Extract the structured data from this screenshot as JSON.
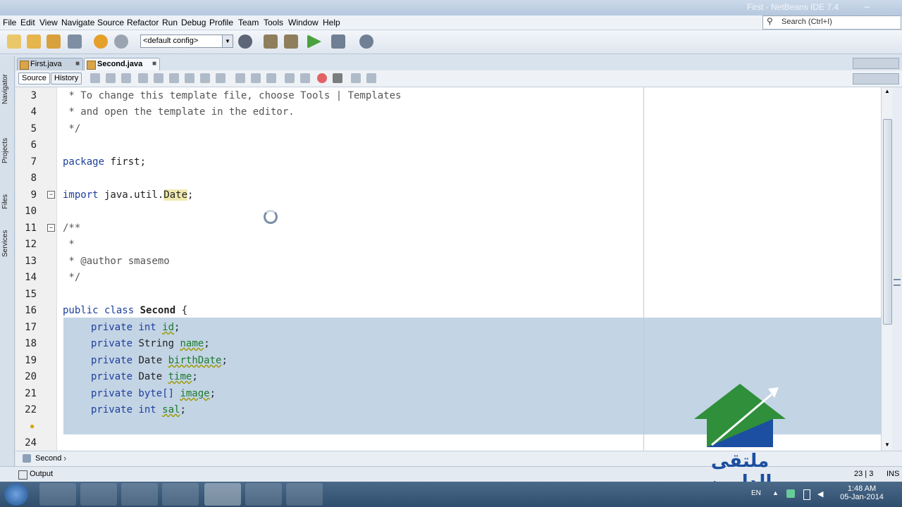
{
  "window": {
    "title": "First - NetBeans IDE 7.4"
  },
  "menu": [
    "File",
    "Edit",
    "View",
    "Navigate",
    "Source",
    "Refactor",
    "Run",
    "Debug",
    "Profile",
    "Team",
    "Tools",
    "Window",
    "Help"
  ],
  "search": {
    "placeholder": "Search (Ctrl+I)"
  },
  "toolbar": {
    "config_value": "<default config>"
  },
  "side_tabs": [
    "Navigator",
    "Projects",
    "Files",
    "Services"
  ],
  "tabs": [
    {
      "label": "First.java",
      "active": false
    },
    {
      "label": "Second.java",
      "active": true
    }
  ],
  "editor_tabs": {
    "source": "Source",
    "history": "History"
  },
  "code_lines": [
    {
      "num": "3",
      "text": " * To change this template file, choose Tools | Templates"
    },
    {
      "num": "4",
      "text": " * and open the template in the editor."
    },
    {
      "num": "5",
      "text": " */"
    },
    {
      "num": "6",
      "text": ""
    },
    {
      "num": "7",
      "kw": "package",
      "text": " first;"
    },
    {
      "num": "8",
      "text": ""
    },
    {
      "num": "9",
      "kw": "import",
      "text": " java.util.",
      "hl": "Date",
      "tail": ";"
    },
    {
      "num": "10",
      "text": ""
    },
    {
      "num": "11",
      "text": "/**"
    },
    {
      "num": "12",
      "text": " *"
    },
    {
      "num": "13",
      "text": " * @author smasemo"
    },
    {
      "num": "14",
      "text": " */"
    },
    {
      "num": "15",
      "text": ""
    },
    {
      "num": "16",
      "kw": "public class",
      "cls": "Second",
      "tail": " {"
    },
    {
      "num": "17",
      "kw": "private int",
      "fld": "id",
      "tail": ";"
    },
    {
      "num": "18",
      "kw": "private",
      "type": "String",
      "fld": "name",
      "tail": ";"
    },
    {
      "num": "19",
      "kw": "private",
      "type": "Date",
      "fld": "birthDate",
      "tail": ";"
    },
    {
      "num": "20",
      "kw": "private",
      "type": "Date",
      "fld": "time",
      "tail": ";"
    },
    {
      "num": "21",
      "kw": "private byte[]",
      "fld": "image",
      "tail": ";"
    },
    {
      "num": "22",
      "kw": "private int",
      "fld": "sal",
      "tail": ";"
    },
    {
      "num": "",
      "text": ""
    },
    {
      "num": "24",
      "text": ""
    }
  ],
  "breadcrumb": {
    "item": "Second"
  },
  "status": {
    "output": "Output",
    "position": "23 | 3",
    "mode": "INS"
  },
  "taskbar": {
    "lang": "EN",
    "time": "1:48 AM",
    "date": "05-Jan-2014"
  },
  "watermark": {
    "text": "ملتقى الدارين"
  }
}
